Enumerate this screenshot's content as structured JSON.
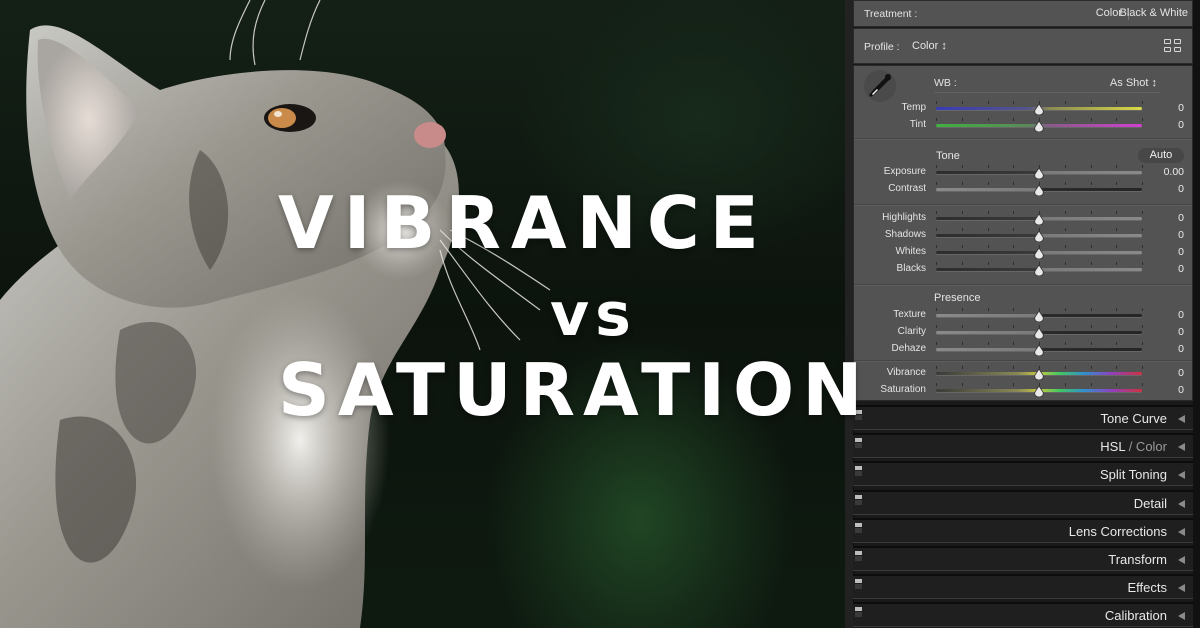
{
  "overlay": {
    "line1": "VIBRANCE",
    "line2": "vs",
    "line3": "SATURATION"
  },
  "panel": {
    "treatment": {
      "label": "Treatment :",
      "options": [
        "Color",
        "Black & White"
      ],
      "selected": "Color"
    },
    "profile": {
      "label": "Profile :",
      "value": "Color ↕",
      "browser_icon": "grid-icon"
    },
    "wb": {
      "label": "WB :",
      "value": "As Shot ↕",
      "eyedropper_icon": "eyedropper-icon"
    },
    "wb_sliders": [
      {
        "name": "Temp",
        "value": "0",
        "position": 0.5
      },
      {
        "name": "Tint",
        "value": "0",
        "position": 0.5
      }
    ],
    "tone": {
      "title": "Tone",
      "auto_label": "Auto",
      "sliders": [
        {
          "name": "Exposure",
          "value": "0.00",
          "position": 0.5
        },
        {
          "name": "Contrast",
          "value": "0",
          "position": 0.5
        }
      ],
      "sliders2": [
        {
          "name": "Highlights",
          "value": "0",
          "position": 0.5
        },
        {
          "name": "Shadows",
          "value": "0",
          "position": 0.5
        },
        {
          "name": "Whites",
          "value": "0",
          "position": 0.5
        },
        {
          "name": "Blacks",
          "value": "0",
          "position": 0.5
        }
      ]
    },
    "presence": {
      "title": "Presence",
      "sliders": [
        {
          "name": "Texture",
          "value": "0",
          "position": 0.5
        },
        {
          "name": "Clarity",
          "value": "0",
          "position": 0.5
        },
        {
          "name": "Dehaze",
          "value": "0",
          "position": 0.5
        }
      ],
      "color_sliders": [
        {
          "name": "Vibrance",
          "value": "0",
          "position": 0.5
        },
        {
          "name": "Saturation",
          "value": "0",
          "position": 0.5
        }
      ]
    },
    "collapsed_sections": [
      {
        "title": "Tone Curve"
      },
      {
        "title": "HSL",
        "suffix": "Color"
      },
      {
        "title": "Split Toning"
      },
      {
        "title": "Detail"
      },
      {
        "title": "Lens Corrections"
      },
      {
        "title": "Transform"
      },
      {
        "title": "Effects"
      },
      {
        "title": "Calibration"
      }
    ]
  }
}
